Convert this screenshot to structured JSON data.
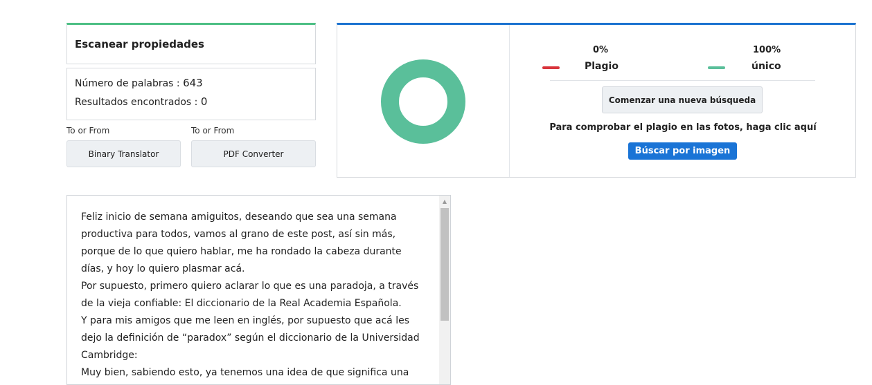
{
  "scan": {
    "title": "Escanear propiedades",
    "word_count_label": "Número de palabras : ",
    "word_count": "643",
    "results_label": "Resultados encontrados : ",
    "results": "0"
  },
  "tools": [
    {
      "caption": "To or From",
      "button": "Binary Translator"
    },
    {
      "caption": "To or From",
      "button": "PDF Converter"
    }
  ],
  "result": {
    "plagiarism_pct": "0%",
    "plagiarism_label": "Plagio",
    "unique_pct": "100%",
    "unique_label": "único",
    "plagiarism_value": 0,
    "unique_value": 100,
    "new_search_button": "Comenzar una nueva búsqueda",
    "photo_note": "Para comprobar el plagio en las fotos, haga clic aquí",
    "image_search_button": "Búscar por imagen"
  },
  "colors": {
    "plagiarism": "#d9343b",
    "unique": "#5abf9a",
    "primary": "#1a74d6"
  },
  "text_paragraphs": [
    "Feliz inicio de semana amiguitos, deseando que sea una semana productiva para todos, vamos al grano de este post, así sin más, porque de lo que quiero hablar, me ha rondado la cabeza durante días, y hoy lo quiero plasmar acá.",
    "Por supuesto, primero quiero aclarar lo que es una paradoja, a través de la vieja confiable: El diccionario de la Real Academia Española.",
    "Y para mis amigos que me leen en inglés, por supuesto que acá les dejo la definición de “paradox” según el diccionario de la Universidad Cambridge:",
    "Muy bien, sabiendo esto, ya tenemos una idea de que significa una"
  ]
}
